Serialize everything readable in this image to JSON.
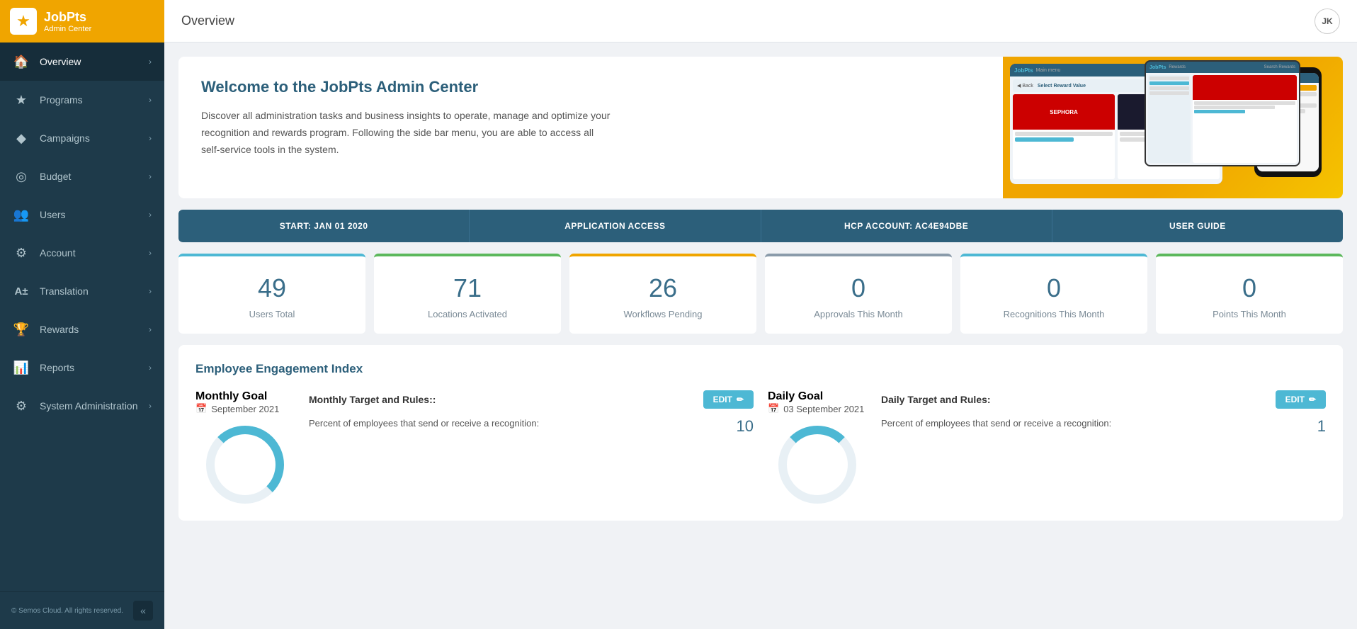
{
  "app": {
    "name": "JobPts",
    "subtitle": "Admin Center",
    "logo_symbol": "★"
  },
  "topbar": {
    "page_title": "Overview",
    "user_initials": "JK"
  },
  "sidebar": {
    "items": [
      {
        "id": "overview",
        "label": "Overview",
        "icon": "🏠",
        "active": true
      },
      {
        "id": "programs",
        "label": "Programs",
        "icon": "★"
      },
      {
        "id": "campaigns",
        "label": "Campaigns",
        "icon": "◆"
      },
      {
        "id": "budget",
        "label": "Budget",
        "icon": "🪙"
      },
      {
        "id": "users",
        "label": "Users",
        "icon": "👥"
      },
      {
        "id": "account",
        "label": "Account",
        "icon": "⚙"
      },
      {
        "id": "translation",
        "label": "Translation",
        "icon": "🔤"
      },
      {
        "id": "rewards",
        "label": "Rewards",
        "icon": "🏆"
      },
      {
        "id": "reports",
        "label": "Reports",
        "icon": "📊"
      },
      {
        "id": "system-admin",
        "label": "System Administration",
        "icon": "⚙"
      }
    ],
    "footer_text": "© Semos Cloud. All rights reserved."
  },
  "welcome": {
    "title": "Welcome to the JobPts Admin Center",
    "description": "Discover all administration tasks and business insights to operate, manage and optimize your recognition and rewards program. Following the side bar menu, you are able to access all self-service tools in the system."
  },
  "action_bar": {
    "items": [
      {
        "label": "START: JAN 01 2020"
      },
      {
        "label": "APPLICATION ACCESS"
      },
      {
        "label": "HCP ACCOUNT: AC4E94DBE"
      },
      {
        "label": "USER GUIDE"
      }
    ]
  },
  "stats": [
    {
      "number": "49",
      "label": "Users Total",
      "color": "blue"
    },
    {
      "number": "71",
      "label": "Locations Activated",
      "color": "green"
    },
    {
      "number": "26",
      "label": "Workflows Pending",
      "color": "gold"
    },
    {
      "number": "0",
      "label": "Approvals This Month",
      "color": "gray"
    },
    {
      "number": "0",
      "label": "Recognitions This Month",
      "color": "blue2"
    },
    {
      "number": "0",
      "label": "Points This Month",
      "color": "green2"
    }
  ],
  "engagement": {
    "section_title": "Employee Engagement Index",
    "monthly": {
      "goal_label": "Monthly Goal",
      "goal_date": "September 2021",
      "rules_title": "Monthly Target and Rules::",
      "edit_label": "EDIT",
      "rules": [
        {
          "label": "Percent of employees that send or receive a recognition:",
          "value": "10"
        }
      ]
    },
    "daily": {
      "goal_label": "Daily Goal",
      "goal_date": "03 September 2021",
      "rules_title": "Daily Target and Rules:",
      "edit_label": "EDIT",
      "rules": [
        {
          "label": "Percent of employees that send or receive a recognition:",
          "value": "1"
        }
      ]
    }
  }
}
